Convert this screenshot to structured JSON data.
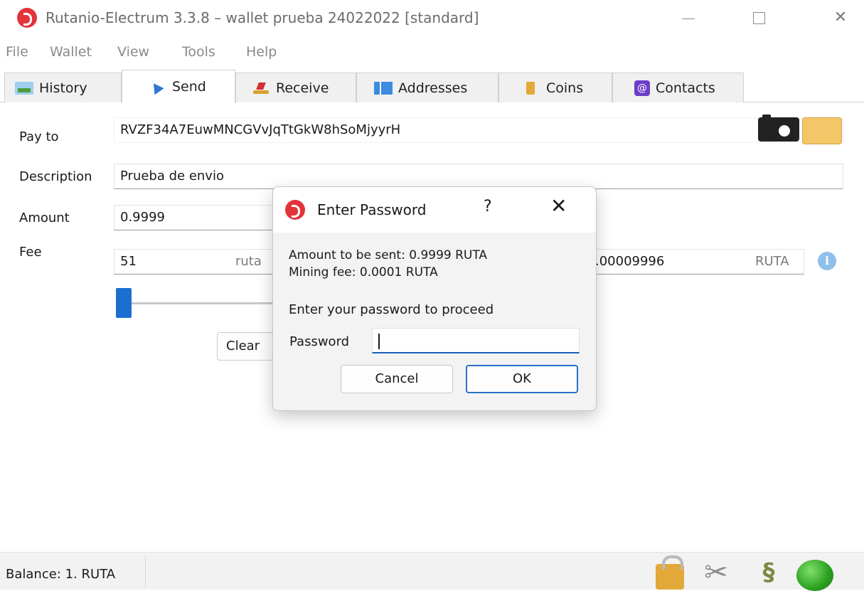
{
  "window": {
    "title": "Rutanio-Electrum 3.3.8  –  wallet prueba 24022022  [standard]",
    "controls": {
      "minimize": "—",
      "maximize": "☐",
      "close": "✕"
    }
  },
  "menu": [
    "File",
    "Wallet",
    "View",
    "Tools",
    "Help"
  ],
  "tabs": [
    {
      "label": "History",
      "icon": "history-icon"
    },
    {
      "label": "Send",
      "icon": "send-icon"
    },
    {
      "label": "Receive",
      "icon": "receive-icon"
    },
    {
      "label": "Addresses",
      "icon": "addresses-icon"
    },
    {
      "label": "Coins",
      "icon": "coins-icon"
    },
    {
      "label": "Contacts",
      "icon": "contacts-icon"
    }
  ],
  "send": {
    "pay_to_label": "Pay to",
    "pay_to_value": "RVZF34A7EuwMNCGVvJqTtGkW8hSoMjyyrH",
    "description_label": "Description",
    "description_value": "Prueba de envio",
    "amount_label": "Amount",
    "amount_value": "0.9999",
    "fee_label": "Fee",
    "fee_rate_value": "51",
    "fee_rate_unit": "ruta",
    "fee_total_value": ".00009996",
    "fee_total_unit": "RUTA",
    "clear_label": "Clear"
  },
  "dialog": {
    "title": "Enter Password",
    "help": "?",
    "close": "✕",
    "amount_line": "Amount to be sent: 0.9999 RUTA",
    "fee_line": "Mining fee: 0.0001 RUTA",
    "prompt": "Enter your password to proceed",
    "password_label": "Password",
    "password_value": "",
    "cancel_label": "Cancel",
    "ok_label": "OK"
  },
  "status": {
    "balance": "Balance: 1. RUTA",
    "connection": "connected"
  },
  "colors": {
    "accent": "#1b6fd1",
    "logo": "#e2343a",
    "status_online": "#2aa01f"
  }
}
